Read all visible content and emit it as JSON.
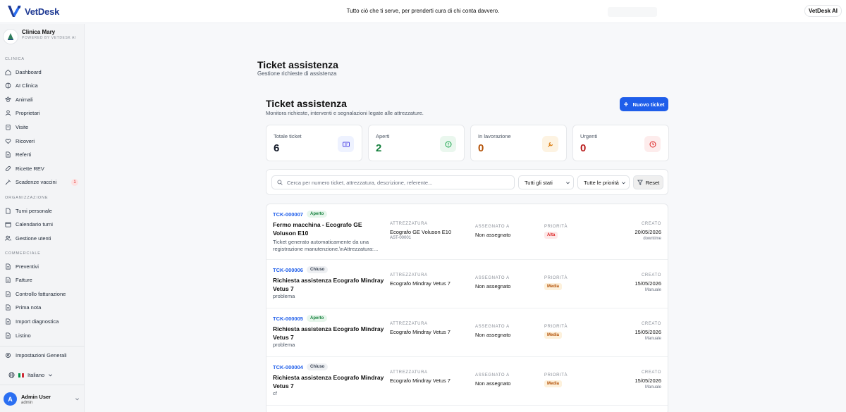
{
  "header": {
    "brand": "VetDesk",
    "tagline": "Tutto ciò che ti serve, per prenderti cura di chi conta davvero.",
    "ai_button": "VetDesk AI"
  },
  "clinic": {
    "name": "Clinica Mary",
    "powered": "POWERED BY VETDESK AI"
  },
  "sidebar": {
    "sections": {
      "clinica": "CLINICA",
      "organizzazione": "ORGANIZZAZIONE",
      "commerciale": "COMMERCIALE"
    },
    "clinica_items": [
      {
        "label": "Dashboard",
        "icon": "home-icon"
      },
      {
        "label": "AI Clinica",
        "icon": "brain-icon"
      },
      {
        "label": "Animali",
        "icon": "paw-icon"
      },
      {
        "label": "Proprietari",
        "icon": "user-icon"
      },
      {
        "label": "Visite",
        "icon": "clipboard-icon"
      },
      {
        "label": "Ricoveri",
        "icon": "heart-icon"
      },
      {
        "label": "Referti",
        "icon": "file-icon"
      },
      {
        "label": "Ricette REV",
        "icon": "pill-icon"
      },
      {
        "label": "Scadenze vaccini",
        "icon": "syringe-icon",
        "badge": "1"
      }
    ],
    "org_items": [
      {
        "label": "Turni personale",
        "icon": "list-icon"
      },
      {
        "label": "Calendario turni",
        "icon": "calendar-icon"
      },
      {
        "label": "Gestione utenti",
        "icon": "users-icon"
      }
    ],
    "comm_items": [
      {
        "label": "Preventivi",
        "icon": "file-icon"
      },
      {
        "label": "Fatture",
        "icon": "file-icon"
      },
      {
        "label": "Controllo fatturazione",
        "icon": "file-check-icon"
      },
      {
        "label": "Prima nota",
        "icon": "file-icon"
      },
      {
        "label": "Import diagnostica",
        "icon": "file-icon"
      },
      {
        "label": "Listino",
        "icon": "file-icon"
      }
    ],
    "settings": "Impostazioni Generali",
    "language": "Italiano",
    "user": {
      "name": "Admin User",
      "role": "admin",
      "initial": "A"
    }
  },
  "page": {
    "title": "Ticket assistenza",
    "subtitle": "Gestione richieste di assistenza"
  },
  "section": {
    "title": "Ticket assistenza",
    "subtitle": "Monitora richieste, interventi e segnalazioni legate alle attrezzature.",
    "new_button": "Nuovo ticket"
  },
  "stats": [
    {
      "label": "Totale ticket",
      "value": "6",
      "color": "#111827",
      "icon": "ticket-icon"
    },
    {
      "label": "Aperti",
      "value": "2",
      "color": "#15803d",
      "icon": "alert-circle-icon"
    },
    {
      "label": "In lavorazione",
      "value": "0",
      "color": "#b45309",
      "icon": "wrench-icon"
    },
    {
      "label": "Urgenti",
      "value": "0",
      "color": "#b91c1c",
      "icon": "clock-icon"
    }
  ],
  "filters": {
    "search_placeholder": "Cerca per numero ticket, attrezzatura, descrizione, referente...",
    "status_select": "Tutti gli stati",
    "priority_select": "Tutte le priorità",
    "reset": "Reset"
  },
  "columns": {
    "equipment": "ATTREZZATURA",
    "assigned": "ASSEGNATO A",
    "priority": "PRIORITÀ",
    "created": "CREATO"
  },
  "tickets": [
    {
      "id": "TCK-000007",
      "status": "Aperto",
      "title": "Fermo macchina - Ecografo GE Voluson E10",
      "desc": "Ticket generato automaticamente da una registrazione manutenzione.\\nAttrezzatura:...",
      "equipment": "Ecografo GE Voluson E10",
      "asset": "AST-00001",
      "assigned": "Non assegnato",
      "priority": "Alta",
      "date": "20/05/2026",
      "source": "downtime"
    },
    {
      "id": "TCK-000006",
      "status": "Chiuso",
      "title": "Richiesta assistenza Ecografo Mindray Vetus 7",
      "desc": "problema",
      "equipment": "Ecografo Mindray Vetus 7",
      "assigned": "Non assegnato",
      "priority": "Media",
      "date": "15/05/2026",
      "source": "Manuale"
    },
    {
      "id": "TCK-000005",
      "status": "Aperto",
      "title": "Richiesta assistenza Ecografo Mindray Vetus 7",
      "desc": "problema",
      "equipment": "Ecografo Mindray Vetus 7",
      "assigned": "Non assegnato",
      "priority": "Media",
      "date": "15/05/2026",
      "source": "Manuale"
    },
    {
      "id": "TCK-000004",
      "status": "Chiuso",
      "title": "Richiesta assistenza Ecografo Mindray Vetus 7",
      "desc": "cf",
      "equipment": "Ecografo Mindray Vetus 7",
      "assigned": "Non assegnato",
      "priority": "Media",
      "date": "15/05/2026",
      "source": "Manuale"
    }
  ]
}
